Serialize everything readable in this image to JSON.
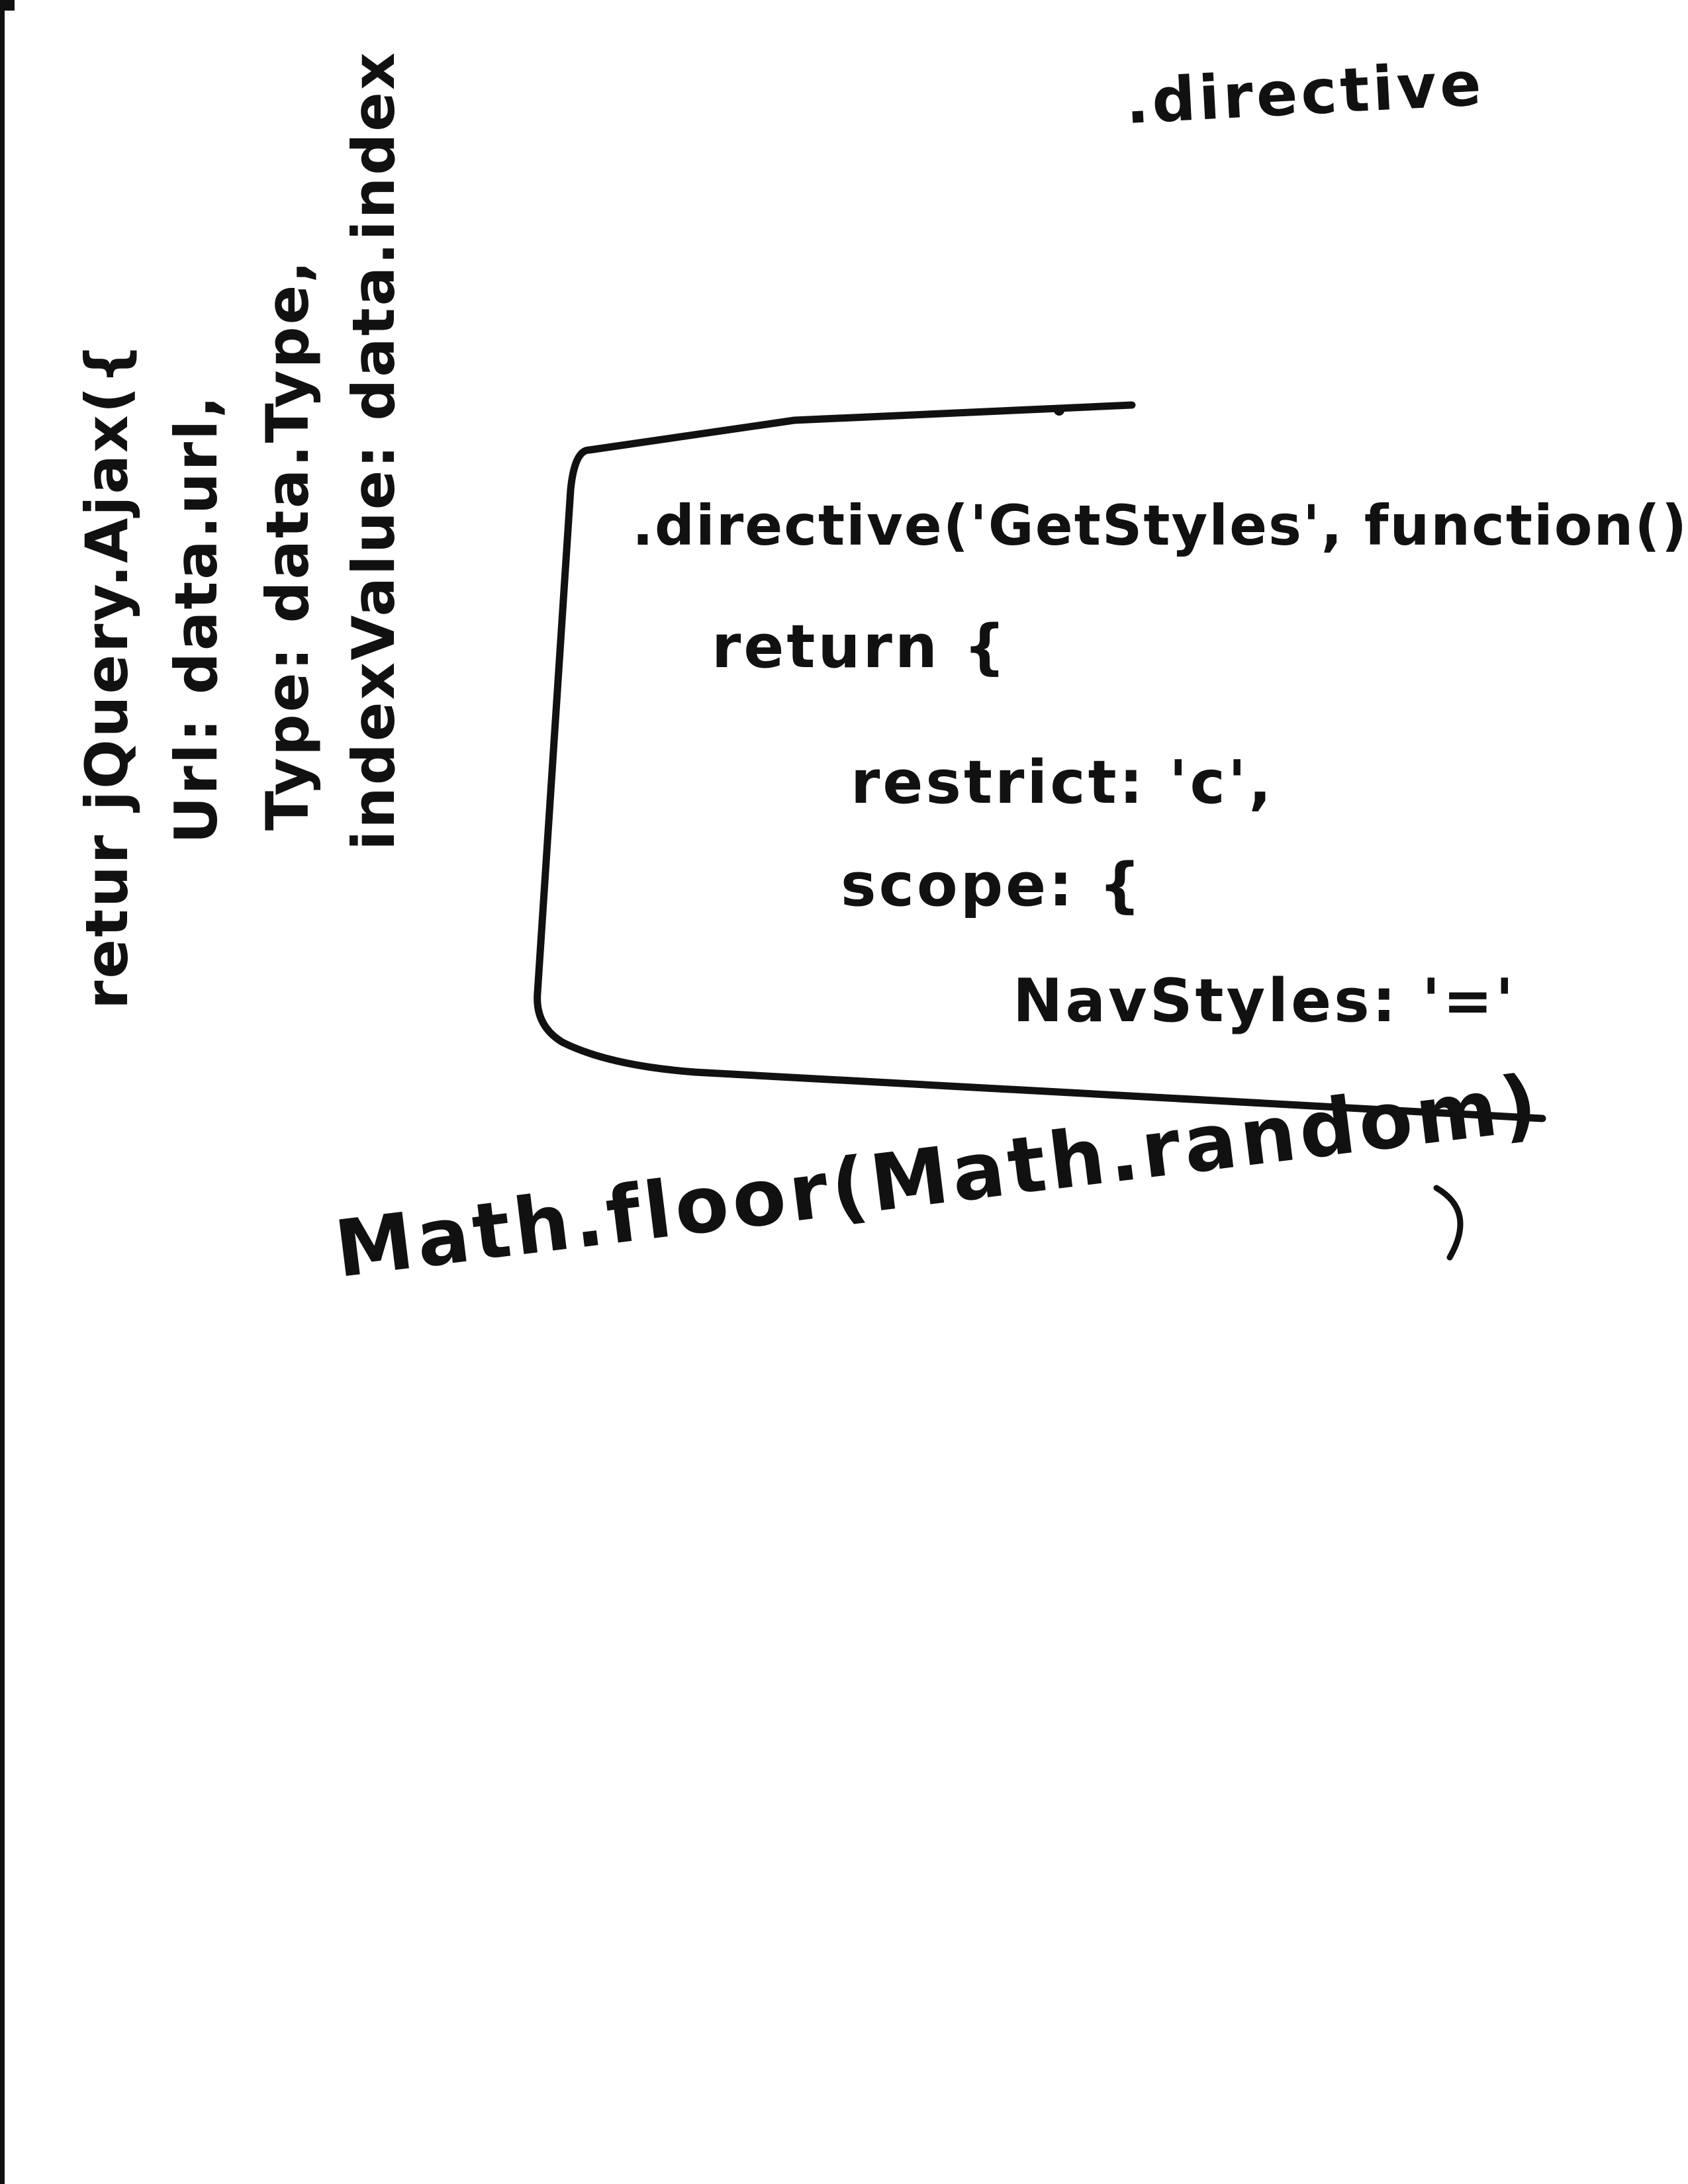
{
  "page": {
    "header_word": ".directive"
  },
  "side_note": {
    "lines": [
      "retur jQuery.Ajax({",
      "Url: data.url,",
      "Type: data.Type,",
      "indexValue: data.index"
    ]
  },
  "code_box": {
    "lines": [
      ".directive('GetStyles', function()",
      "return {",
      "restrict: 'c',",
      "scope: {",
      "NavStyles: '='"
    ]
  },
  "bottom_note": {
    "text": "Math.floor(Math.random)"
  }
}
